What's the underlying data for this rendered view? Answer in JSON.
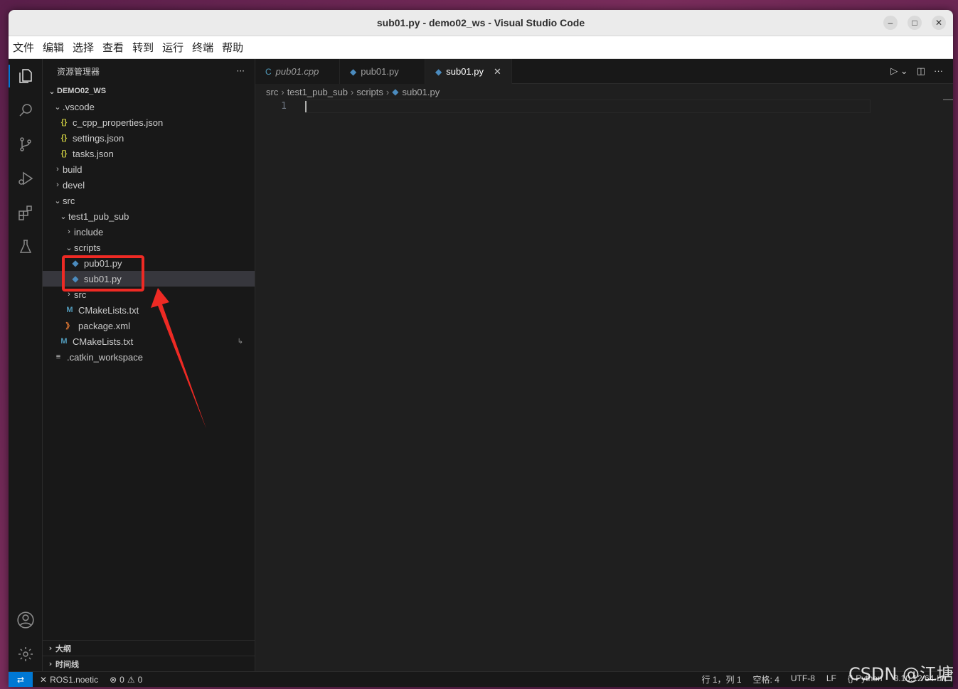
{
  "window": {
    "title": "sub01.py - demo02_ws - Visual Studio Code"
  },
  "menu": [
    "文件",
    "编辑",
    "选择",
    "查看",
    "转到",
    "运行",
    "终端",
    "帮助"
  ],
  "sidebar": {
    "title": "资源管理器",
    "workspace": "DEMO02_WS",
    "tree": [
      {
        "label": ".vscode",
        "type": "folder",
        "open": true,
        "depth": 1
      },
      {
        "label": "c_cpp_properties.json",
        "type": "json",
        "depth": 2
      },
      {
        "label": "settings.json",
        "type": "json",
        "depth": 2
      },
      {
        "label": "tasks.json",
        "type": "json",
        "depth": 2
      },
      {
        "label": "build",
        "type": "folder",
        "open": false,
        "depth": 1
      },
      {
        "label": "devel",
        "type": "folder",
        "open": false,
        "depth": 1
      },
      {
        "label": "src",
        "type": "folder",
        "open": true,
        "depth": 1
      },
      {
        "label": "test1_pub_sub",
        "type": "folder",
        "open": true,
        "depth": 2
      },
      {
        "label": "include",
        "type": "folder",
        "open": false,
        "depth": 3
      },
      {
        "label": "scripts",
        "type": "folder",
        "open": true,
        "depth": 3
      },
      {
        "label": "pub01.py",
        "type": "py",
        "depth": 4
      },
      {
        "label": "sub01.py",
        "type": "py",
        "depth": 4,
        "selected": true
      },
      {
        "label": "src",
        "type": "folder",
        "open": false,
        "depth": 3
      },
      {
        "label": "CMakeLists.txt",
        "type": "cmake",
        "depth": 3
      },
      {
        "label": "package.xml",
        "type": "xml",
        "depth": 3
      },
      {
        "label": "CMakeLists.txt",
        "type": "cmake",
        "depth": 2,
        "modified": true
      },
      {
        "label": ".catkin_workspace",
        "type": "text",
        "depth": 1
      }
    ],
    "panels": [
      "大纲",
      "时间线"
    ]
  },
  "tabs": [
    {
      "label": "pub01.cpp",
      "icon": "cpp",
      "active": false,
      "italic": true
    },
    {
      "label": "pub01.py",
      "icon": "py",
      "active": false
    },
    {
      "label": "sub01.py",
      "icon": "py",
      "active": true
    }
  ],
  "breadcrumb": [
    "src",
    "test1_pub_sub",
    "scripts",
    "sub01.py"
  ],
  "editor": {
    "line_number": "1"
  },
  "statusbar": {
    "remote": "ROS1.noetic",
    "errors": "0",
    "warnings": "0",
    "position": "行 1，列 1",
    "spaces": "空格: 4",
    "encoding": "UTF-8",
    "eol": "LF",
    "language": "Python",
    "interpreter": "3.10.12 64-bit"
  },
  "watermark": "CSDN @江塘",
  "annotation_color": "#ee2a24"
}
